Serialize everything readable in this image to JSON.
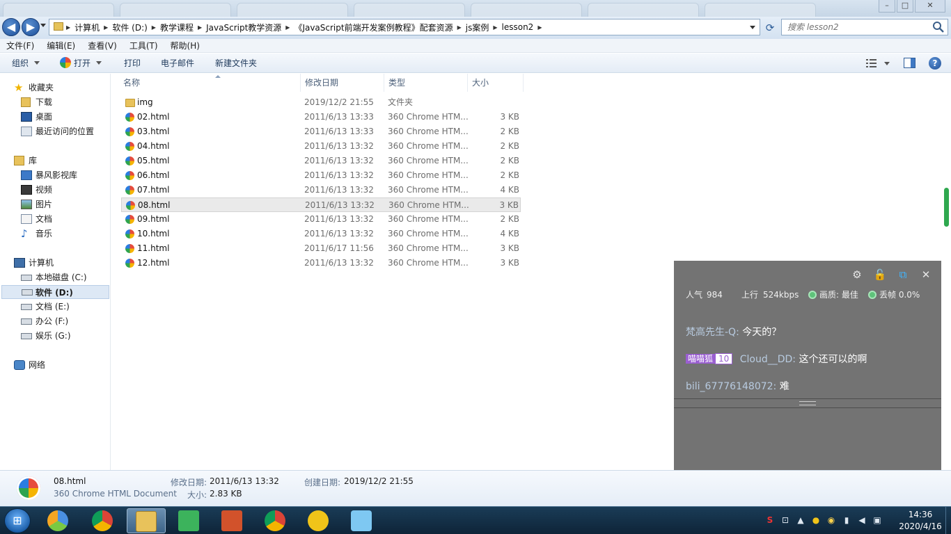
{
  "window": {
    "back_symbol": "◀",
    "forward_symbol": "▶",
    "refresh_symbol": "⟳",
    "minimize_symbol": "–",
    "maximize_symbol": "□",
    "close_symbol": "✕"
  },
  "address": {
    "breadcrumbs": [
      "计算机",
      "软件 (D:)",
      "教学课程",
      "JavaScript教学资源",
      "《JavaScript前端开发案例教程》配套资源",
      "js案例",
      "lesson2"
    ]
  },
  "search": {
    "placeholder": "搜索 lesson2"
  },
  "menubar": {
    "file": "文件(F)",
    "edit": "编辑(E)",
    "view": "查看(V)",
    "tools": "工具(T)",
    "help": "帮助(H)"
  },
  "commandbar": {
    "organize": "组织",
    "open": "打开",
    "print": "打印",
    "email": "电子邮件",
    "new_folder": "新建文件夹",
    "help_symbol": "?"
  },
  "navpane": {
    "favorites": "收藏夹",
    "downloads": "下载",
    "desktop": "桌面",
    "recent": "最近访问的位置",
    "libraries": "库",
    "storm": "暴风影视库",
    "videos": "视频",
    "pictures": "图片",
    "documents": "文档",
    "music": "音乐",
    "computer": "计算机",
    "drive_c": "本地磁盘 (C:)",
    "drive_d": "软件 (D:)",
    "drive_e": "文档 (E:)",
    "drive_f": "办公 (F:)",
    "drive_g": "娱乐 (G:)",
    "network": "网络"
  },
  "columns": {
    "name": "名称",
    "date": "修改日期",
    "type": "类型",
    "size": "大小"
  },
  "files": [
    {
      "name": "img",
      "date": "2019/12/2 21:55",
      "type": "文件夹",
      "size": ""
    },
    {
      "name": "02.html",
      "date": "2011/6/13 13:33",
      "type": "360 Chrome HTM...",
      "size": "3 KB"
    },
    {
      "name": "03.html",
      "date": "2011/6/13 13:33",
      "type": "360 Chrome HTM...",
      "size": "2 KB"
    },
    {
      "name": "04.html",
      "date": "2011/6/13 13:32",
      "type": "360 Chrome HTM...",
      "size": "2 KB"
    },
    {
      "name": "05.html",
      "date": "2011/6/13 13:32",
      "type": "360 Chrome HTM...",
      "size": "2 KB"
    },
    {
      "name": "06.html",
      "date": "2011/6/13 13:32",
      "type": "360 Chrome HTM...",
      "size": "2 KB"
    },
    {
      "name": "07.html",
      "date": "2011/6/13 13:32",
      "type": "360 Chrome HTM...",
      "size": "4 KB"
    },
    {
      "name": "08.html",
      "date": "2011/6/13 13:32",
      "type": "360 Chrome HTM...",
      "size": "3 KB"
    },
    {
      "name": "09.html",
      "date": "2011/6/13 13:32",
      "type": "360 Chrome HTM...",
      "size": "2 KB"
    },
    {
      "name": "10.html",
      "date": "2011/6/13 13:32",
      "type": "360 Chrome HTM...",
      "size": "4 KB"
    },
    {
      "name": "11.html",
      "date": "2011/6/17 11:56",
      "type": "360 Chrome HTM...",
      "size": "3 KB"
    },
    {
      "name": "12.html",
      "date": "2011/6/13 13:32",
      "type": "360 Chrome HTM...",
      "size": "3 KB"
    }
  ],
  "details": {
    "filename": "08.html",
    "filetype": "360 Chrome HTML Document",
    "modified_label": "修改日期:",
    "modified_value": "2011/6/13 13:32",
    "created_label": "创建日期:",
    "created_value": "2019/12/2 21:55",
    "size_label": "大小:",
    "size_value": "2.83 KB"
  },
  "live_panel": {
    "settings_symbol": "⚙",
    "lock_symbol": "🔓",
    "popout_symbol": "⧉",
    "close_symbol": "✕",
    "popularity_label": "人气",
    "popularity_value": "984",
    "upload_label": "上行",
    "upload_value": "524kbps",
    "quality": "画质: 最佳",
    "dropped": "丢帧 0.0%",
    "messages": [
      {
        "user": "梵高先生-Q:",
        "text": "今天的？"
      },
      {
        "medal": "喵喵狐",
        "level": "10",
        "user": "Cloud__DD:",
        "text": "这个还可以的啊"
      },
      {
        "user": "bili_67776148072:",
        "text": "难"
      }
    ]
  },
  "taskbar": {
    "start_symbol": "⊞",
    "time": "14:36",
    "date": "2020/4/16"
  }
}
